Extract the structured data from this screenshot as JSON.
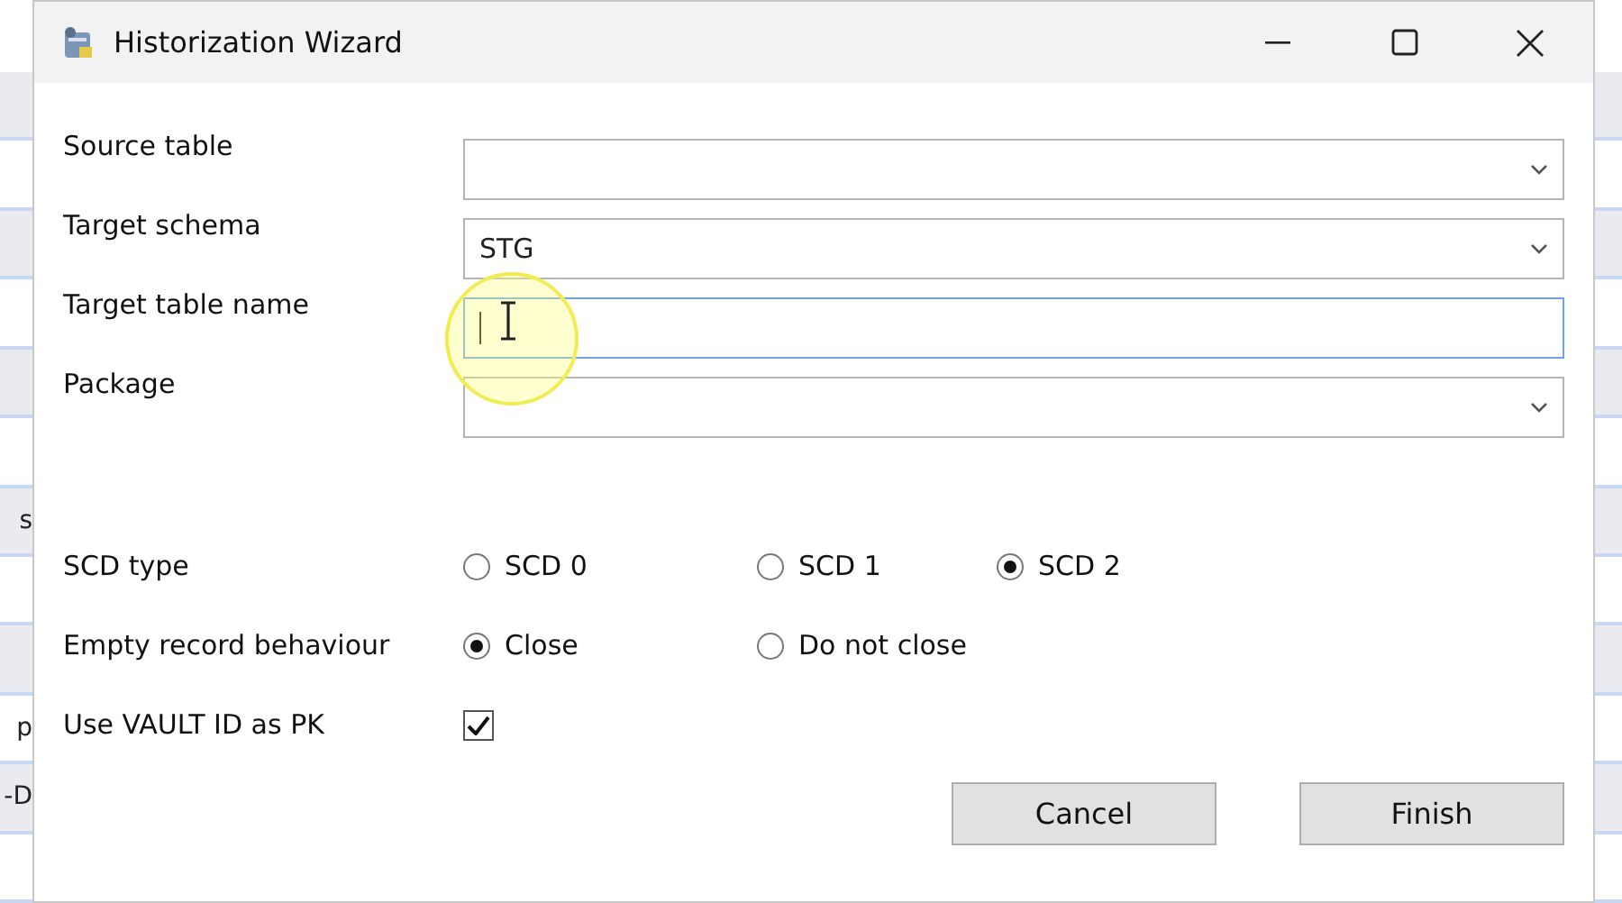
{
  "background": {
    "fragments": [
      "s",
      "p",
      "-D"
    ]
  },
  "window": {
    "title": "Historization Wizard"
  },
  "fields": [
    {
      "label": "Source table",
      "kind": "dropdown",
      "focused": false
    },
    {
      "label": "Target schema",
      "kind": "dropdown",
      "value": "STG",
      "focused": false
    },
    {
      "label": "Target table name",
      "kind": "text",
      "focused": true
    },
    {
      "label": "Package",
      "kind": "dropdown",
      "focused": false
    }
  ],
  "options": [
    {
      "label": "SCD type",
      "kind": "radio",
      "choices": [
        {
          "label": "SCD 0",
          "selected": false
        },
        {
          "label": "SCD 1",
          "selected": false
        },
        {
          "label": "SCD 2",
          "selected": true
        }
      ]
    },
    {
      "label": "Empty record behaviour",
      "kind": "radio",
      "choices": [
        {
          "label": "Close",
          "selected": true
        },
        {
          "label": "Do not close",
          "selected": false
        }
      ]
    },
    {
      "label": "Use VAULT ID as PK",
      "kind": "checkbox",
      "checked": true
    }
  ],
  "buttons": [
    "Cancel",
    "Finish"
  ]
}
